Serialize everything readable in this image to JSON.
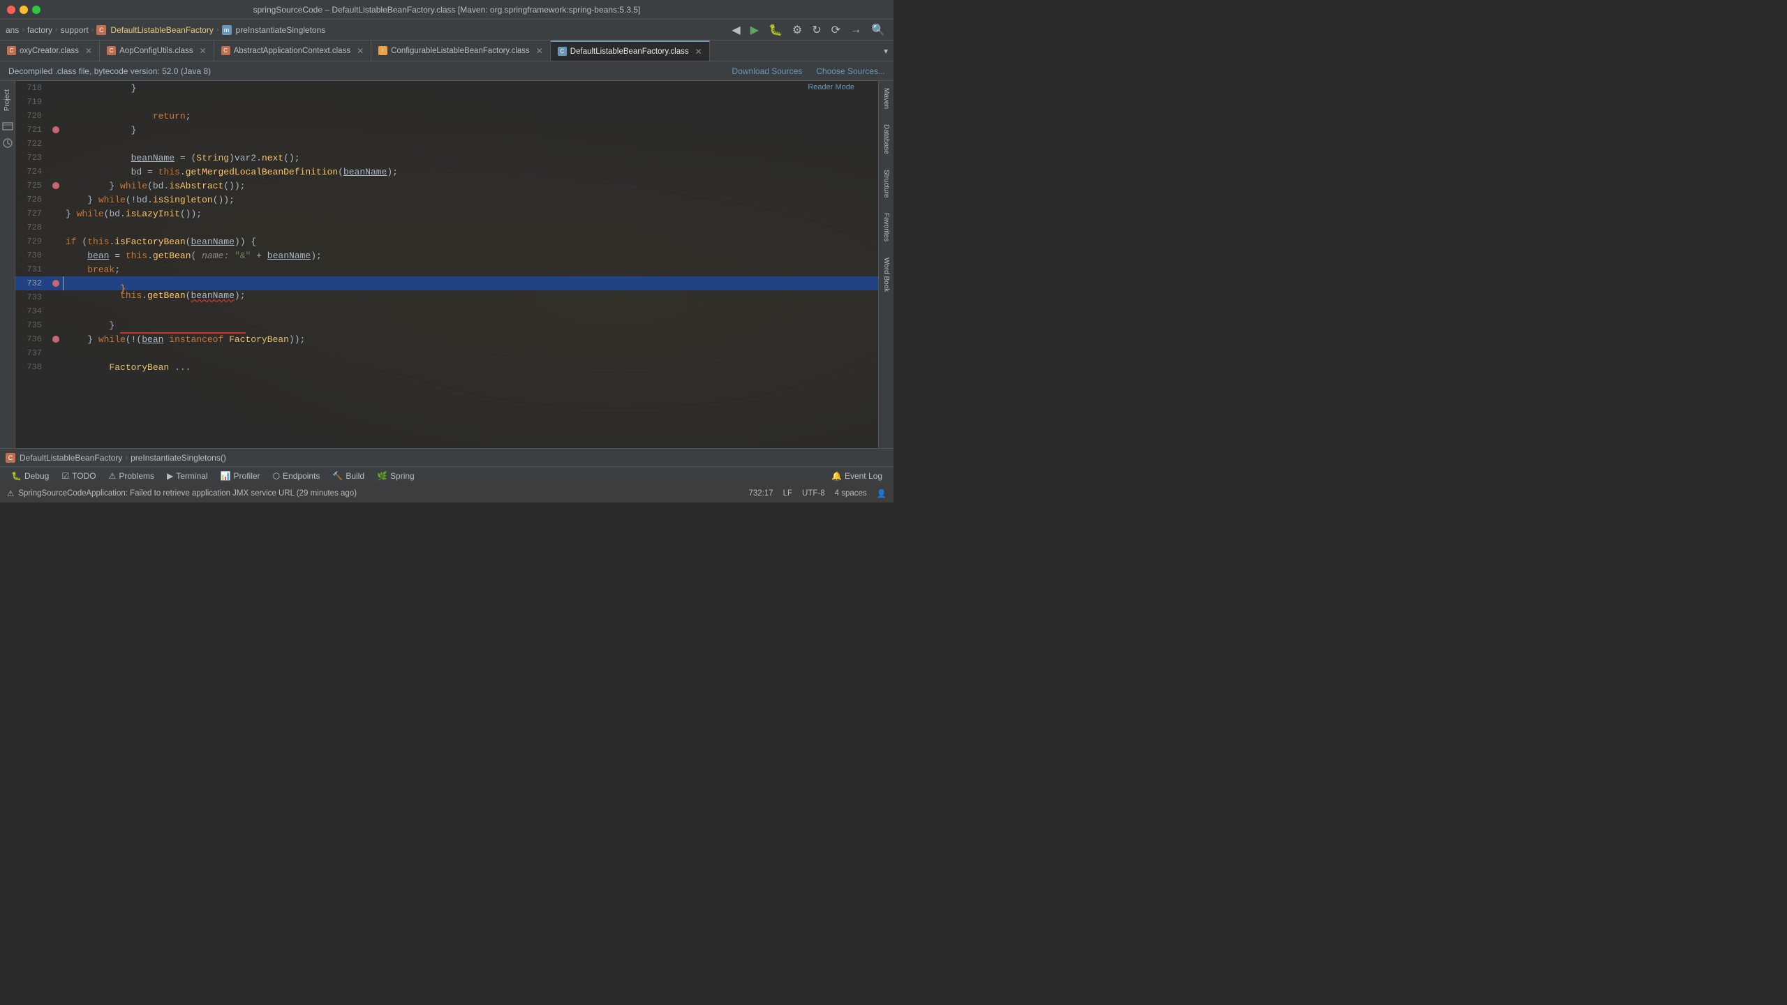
{
  "titleBar": {
    "title": "springSourceCode – DefaultListableBeanFactory.class [Maven: org.springframework:spring-beans:5.3.5]"
  },
  "breadcrumbs": [
    {
      "label": "ans",
      "type": "text"
    },
    {
      "label": "factory",
      "type": "text"
    },
    {
      "label": "support",
      "type": "text"
    },
    {
      "label": "DefaultListableBeanFactory",
      "type": "class",
      "iconType": "class"
    },
    {
      "label": "preInstantiateSingletons",
      "type": "method",
      "iconType": "method"
    }
  ],
  "toolbarIcons": [
    "◀",
    "▶",
    "⚙",
    "↻",
    "⟳",
    "→",
    "⊞",
    "⚑",
    "⬜",
    "🔍"
  ],
  "tabs": [
    {
      "label": "oxyCreator.class",
      "icon": "class",
      "iconColor": "#c07050",
      "active": false
    },
    {
      "label": "AopConfigUtils.class",
      "icon": "class",
      "iconColor": "#c07050",
      "active": false
    },
    {
      "label": "AbstractApplicationContext.class",
      "icon": "class",
      "iconColor": "#c07050",
      "active": false
    },
    {
      "label": "ConfigurableListableBeanFactory.class",
      "icon": "class",
      "iconColor": "#f0a040",
      "active": false
    },
    {
      "label": "DefaultListableBeanFactory.class",
      "icon": "class",
      "iconColor": "#6897bb",
      "active": true
    }
  ],
  "infoBar": {
    "text": "Decompiled .class file, bytecode version: 52.0 (Java 8)",
    "downloadSources": "Download Sources",
    "chooseSources": "Choose Sources..."
  },
  "readerMode": "Reader Mode",
  "codeLines": [
    {
      "num": 718,
      "code": "            }",
      "indent": 12
    },
    {
      "num": 719,
      "code": "",
      "indent": 0
    },
    {
      "num": 720,
      "code": "                return;",
      "kw": [
        "return"
      ]
    },
    {
      "num": 721,
      "code": "            }",
      "breakpoint": true
    },
    {
      "num": 722,
      "code": ""
    },
    {
      "num": 723,
      "code": "            beanName = (String)var2.next();",
      "underline_start": 12,
      "underline_text": "beanName"
    },
    {
      "num": 724,
      "code": "            bd = this.getMergedLocalBeanDefinition(beanName);",
      "underline_start": 27,
      "underline_text": "beanName"
    },
    {
      "num": 725,
      "code": "        } while(bd.isAbstract());",
      "breakpoint": true
    },
    {
      "num": 726,
      "code": "    } while(!bd.isSingleton());"
    },
    {
      "num": 727,
      "code": "} while(bd.isLazyInit());"
    },
    {
      "num": 728,
      "code": ""
    },
    {
      "num": 729,
      "code": "if (this.isFactoryBean(beanName)) {"
    },
    {
      "num": 730,
      "code": "    bean = this.getBean( name: \"&\" + beanName);"
    },
    {
      "num": 731,
      "code": "    break;"
    },
    {
      "num": 732,
      "code": "}",
      "highlighted": true
    },
    {
      "num": 733,
      "code": ""
    },
    {
      "num": 734,
      "code": "this.getBean(beanName);",
      "red_underline_range": [
        0,
        22
      ]
    },
    {
      "num": 735,
      "code": "        }",
      "has_line": true
    },
    {
      "num": 736,
      "code": "    } while(!(bean instanceof FactoryBean));",
      "breakpoint": true
    },
    {
      "num": 737,
      "code": ""
    },
    {
      "num": 738,
      "code": "        FactoryBean ...",
      "partial": true
    }
  ],
  "bottomBreadcrumb": {
    "class": "DefaultListableBeanFactory",
    "method": "preInstantiateSingletons()"
  },
  "bottomTabs": [
    {
      "label": "Debug",
      "icon": "🐛"
    },
    {
      "label": "TODO",
      "icon": "☑"
    },
    {
      "label": "Problems",
      "icon": "⚠"
    },
    {
      "label": "Terminal",
      "icon": "▶"
    },
    {
      "label": "Profiler",
      "icon": "📊"
    },
    {
      "label": "Endpoints",
      "icon": "⬡"
    },
    {
      "label": "Build",
      "icon": "🔨"
    },
    {
      "label": "Spring",
      "icon": "🌿"
    }
  ],
  "eventLog": "Event Log",
  "statusBar": {
    "message": "SpringSourceCodeApplication: Failed to retrieve application JMX service URL (29 minutes ago)",
    "position": "732:17",
    "lineEnding": "LF",
    "encoding": "UTF-8",
    "indent": "4 spaces",
    "icon": "⚠"
  },
  "rightSidebar": [
    "Maven",
    "Database",
    "Structure",
    "Favorites",
    "Word Book"
  ],
  "leftSidebar": [
    "Project"
  ]
}
